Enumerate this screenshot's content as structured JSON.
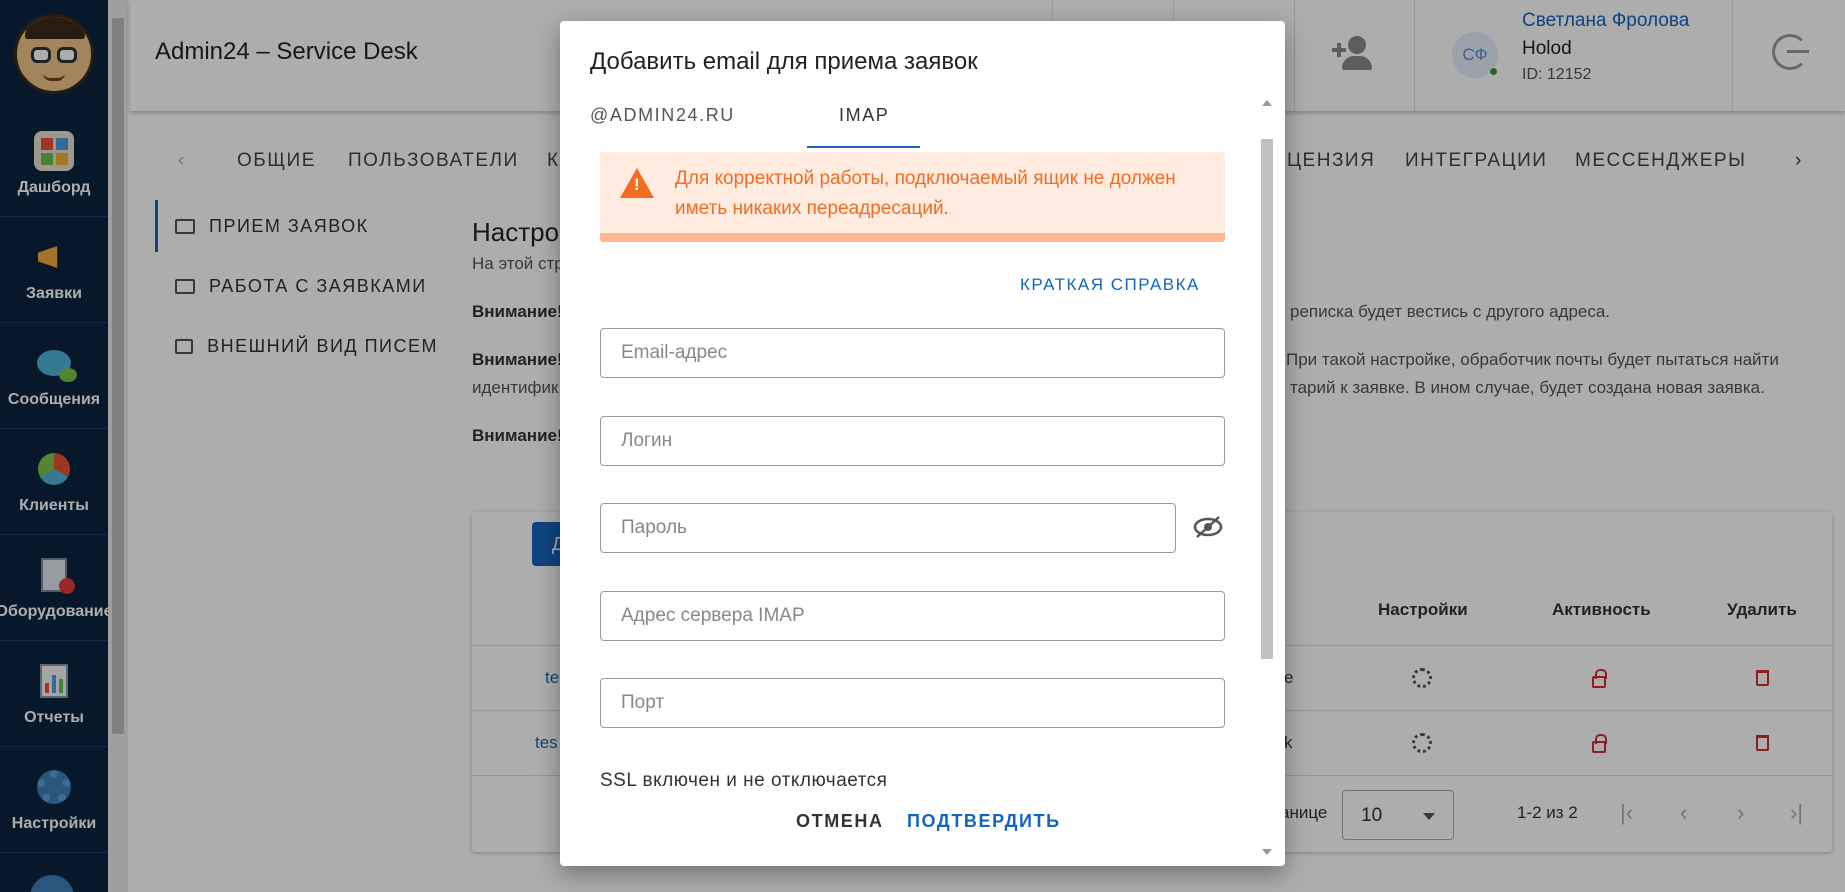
{
  "sidebar": {
    "items": [
      {
        "label": "Дашборд",
        "icon": "dashboard-icon"
      },
      {
        "label": "Заявки",
        "icon": "megaphone-icon"
      },
      {
        "label": "Сообщения",
        "icon": "chat-icon"
      },
      {
        "label": "Клиенты",
        "icon": "clients-icon"
      },
      {
        "label": "Оборудование",
        "icon": "equipment-icon"
      },
      {
        "label": "Отчеты",
        "icon": "reports-icon"
      },
      {
        "label": "Настройки",
        "icon": "gear-icon"
      }
    ]
  },
  "header": {
    "title": "Admin24 – Service Desk",
    "user": {
      "initials": "СФ",
      "name": "Светлана Фролова",
      "org": "Holod",
      "id": "ID: 12152"
    }
  },
  "main_tabs": [
    "ОБЩИЕ",
    "ПОЛЬЗОВАТЕЛИ",
    "К",
    "ЦЕНЗИЯ",
    "ИНТЕГРАЦИИ",
    "МЕССЕНДЖЕРЫ"
  ],
  "settings_menu": [
    "ПРИЕМ ЗАЯВОК",
    "РАБОТА С ЗАЯВКАМИ",
    "ВНЕШНИЙ ВИД ПИСЕМ"
  ],
  "page": {
    "heading": "Настро",
    "subtitle": "На этой стр",
    "note1_label": "Внимание!",
    "note1_tail": "реписка будет вестись с другого адреса.",
    "note2_label": "Внимание!",
    "note2_tail": "При такой настройке, обработчик почты будет пытаться найти",
    "note2_line2_start": "идентифик",
    "note2_line2_tail": "тарий к заявке. В ином случае, будет создана новая заявка.",
    "note3_label": "Внимание!"
  },
  "table": {
    "add_btn": "Д",
    "headers": {
      "settings": "Настройки",
      "activity": "Активность",
      "delete": "Удалить"
    },
    "rows": [
      {
        "email": "te",
        "status": "e"
      },
      {
        "email": "tes",
        "status": "k"
      }
    ],
    "per_page_label": "анице",
    "per_page_value": "10",
    "range": "1-2 из 2"
  },
  "dialog": {
    "title": "Добавить email для приема заявок",
    "tabs": [
      "@ADMIN24.RU",
      "IMAP"
    ],
    "alert": "Для корректной работы, подключаемый ящик не должен иметь никаких переадресаций.",
    "help_link": "КРАТКАЯ СПРАВКА",
    "fields": {
      "email": "Email-адрес",
      "login": "Логин",
      "password": "Пароль",
      "imap_server": "Адрес сервера IMAP",
      "port": "Порт"
    },
    "ssl_text": "SSL включен и не отключается",
    "cancel": "ОТМЕНА",
    "confirm": "ПОДТВЕРДИТЬ"
  },
  "colors": {
    "sidebar": "#0d2440",
    "accent": "#1565c0",
    "warning": "#f26c22",
    "danger": "#d32f2f"
  }
}
